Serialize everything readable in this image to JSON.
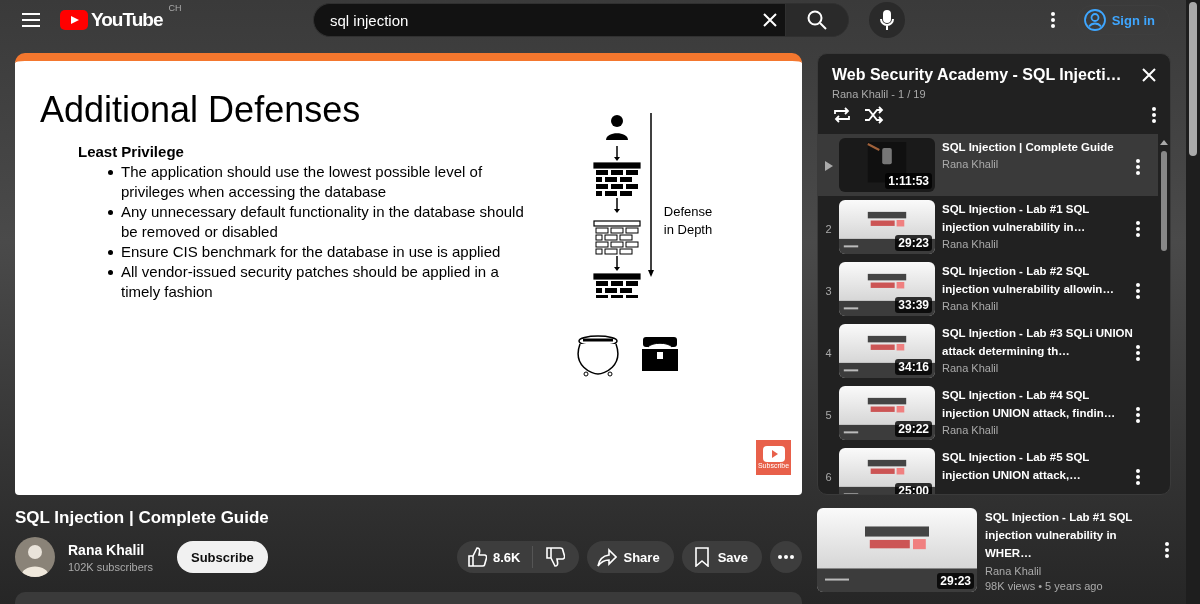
{
  "header": {
    "logo": "YouTube",
    "country_code": "CH",
    "search": {
      "value": "sql injection"
    },
    "sign_in": "Sign in"
  },
  "video": {
    "slide": {
      "title": "Additional Defenses",
      "heading": "Least Privilege",
      "bullets": [
        "The application should use the lowest possible level of privileges when accessing the database",
        "Any unnecessary default functionality in the database should be removed or disabled",
        "Ensure CIS benchmark for the database in use is applied",
        "All vendor-issued security patches should be applied in a timely fashion"
      ],
      "diagram_label": "Defense in Depth",
      "branding_label": "Subscribe"
    },
    "title": "SQL Injection | Complete Guide",
    "channel": {
      "name": "Rana Khalil",
      "subscribers": "102K subscribers"
    },
    "subscribe": "Subscribe",
    "likes": "8.6K",
    "actions": [
      {
        "kind": "share",
        "label": "Share"
      },
      {
        "kind": "save",
        "label": "Save"
      }
    ]
  },
  "playlist": {
    "title": "Web Security Academy - SQL Injecti…",
    "meta": "Rana Khalil - 1 / 19",
    "items": [
      {
        "selected": true,
        "title": "SQL Injection | Complete Guide",
        "author": "Rana Khalil",
        "duration": "1:11:53"
      },
      {
        "selected": false,
        "index": "2",
        "title": "SQL Injection - Lab #1 SQL injection vulnerability in…",
        "author": "Rana Khalil",
        "duration": "29:23"
      },
      {
        "selected": false,
        "index": "3",
        "title": "SQL Injection - Lab #2 SQL injection vulnerability allowin…",
        "author": "Rana Khalil",
        "duration": "33:39"
      },
      {
        "selected": false,
        "index": "4",
        "title": "SQL Injection - Lab #3 SQLi UNION attack determining th…",
        "author": "Rana Khalil",
        "duration": "34:16"
      },
      {
        "selected": false,
        "index": "5",
        "title": "SQL Injection - Lab #4 SQL injection UNION attack, findin…",
        "author": "Rana Khalil",
        "duration": "29:22"
      },
      {
        "selected": false,
        "index": "6",
        "title": "SQL Injection - Lab #5 SQL injection UNION attack,…",
        "duration": "25:00"
      }
    ]
  },
  "recommended": [
    {
      "title": "SQL Injection - Lab #1 SQL injection vulnerability in WHER…",
      "author": "Rana Khalil",
      "stats": "98K views • 5 years ago",
      "duration": "29:23"
    }
  ]
}
